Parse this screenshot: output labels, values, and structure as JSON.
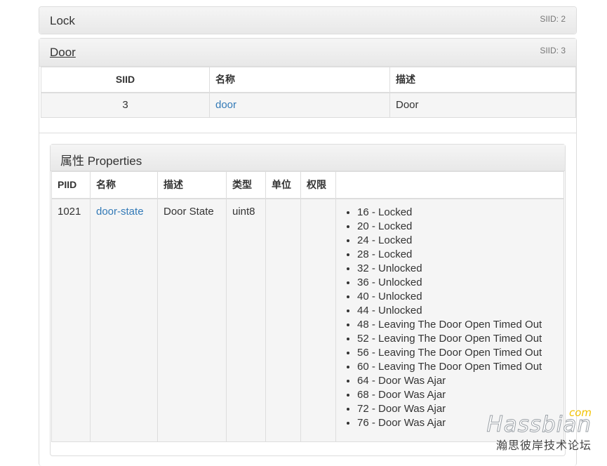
{
  "lock": {
    "title": "Lock",
    "siid": "SIID: 2"
  },
  "door": {
    "title": "Door",
    "siid": "SIID: 3",
    "headers": [
      "SIID",
      "名称",
      "描述"
    ],
    "row": {
      "siid": "3",
      "name": "door",
      "desc": "Door"
    }
  },
  "properties": {
    "title": "属性 Properties",
    "headers": [
      "PIID",
      "名称",
      "描述",
      "类型",
      "单位",
      "权限",
      ""
    ],
    "row": {
      "piid": "1021",
      "name": "door-state",
      "desc": "Door State",
      "type": "uint8",
      "unit": "",
      "access": ""
    },
    "values": [
      "16 - Locked",
      "20 - Locked",
      "24 - Locked",
      "28 - Locked",
      "32 - Unlocked",
      "36 - Unlocked",
      "40 - Unlocked",
      "44 - Unlocked",
      "48 - Leaving The Door Open Timed Out",
      "52 - Leaving The Door Open Timed Out",
      "56 - Leaving The Door Open Timed Out",
      "60 - Leaving The Door Open Timed Out",
      "64 - Door Was Ajar",
      "68 - Door Was Ajar",
      "72 - Door Was Ajar",
      "76 - Door Was Ajar"
    ]
  },
  "watermark": {
    "com": "com",
    "main": "Hassbian",
    "sub": "瀚思彼岸技术论坛"
  }
}
